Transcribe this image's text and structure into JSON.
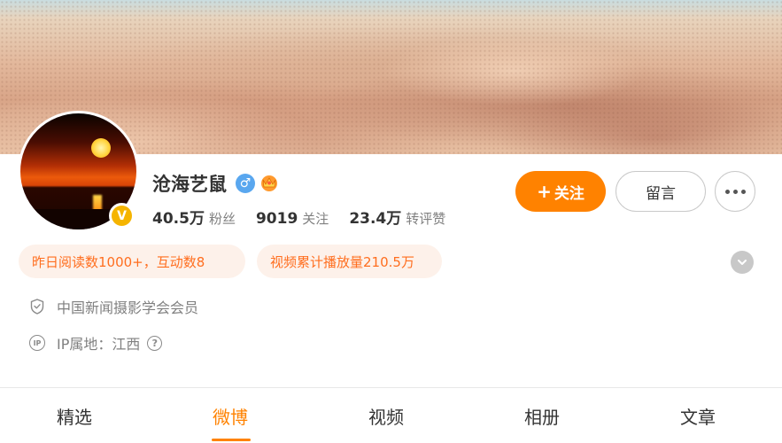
{
  "profile": {
    "name": "沧海艺鼠",
    "gender_symbol": "♂",
    "verified_symbol": "V",
    "stats": [
      {
        "value": "40.5万",
        "label": "粉丝"
      },
      {
        "value": "9019",
        "label": "关注"
      },
      {
        "value": "23.4万",
        "label": "转评赞"
      }
    ]
  },
  "actions": {
    "follow_plus": "+",
    "follow_label": "关注",
    "message_label": "留言"
  },
  "tags": {
    "reads": "昨日阅读数1000+，互动数8",
    "video_plays": "视频累计播放量210.5万"
  },
  "info": {
    "membership": "中国新闻摄影学会会员",
    "ip_icon_text": "IP",
    "ip_location": "IP属地：江西",
    "help_symbol": "?"
  },
  "tabs": [
    {
      "label": "精选"
    },
    {
      "label": "微博",
      "active": true
    },
    {
      "label": "视频"
    },
    {
      "label": "相册"
    },
    {
      "label": "文章"
    }
  ],
  "colors": {
    "accent": "#ff8200",
    "tag_text": "#ff6e1f",
    "tag_bg": "#fdf1ea",
    "verified": "#f5b400",
    "gender": "#59a7ef"
  },
  "icons": {
    "gender": "male-icon",
    "vip": "vip-crown-icon",
    "verified": "verified-badge-icon",
    "more": "more-dots-icon",
    "expand": "chevron-down-icon",
    "membership": "shield-icon",
    "ip": "ip-location-icon",
    "help": "help-icon"
  }
}
